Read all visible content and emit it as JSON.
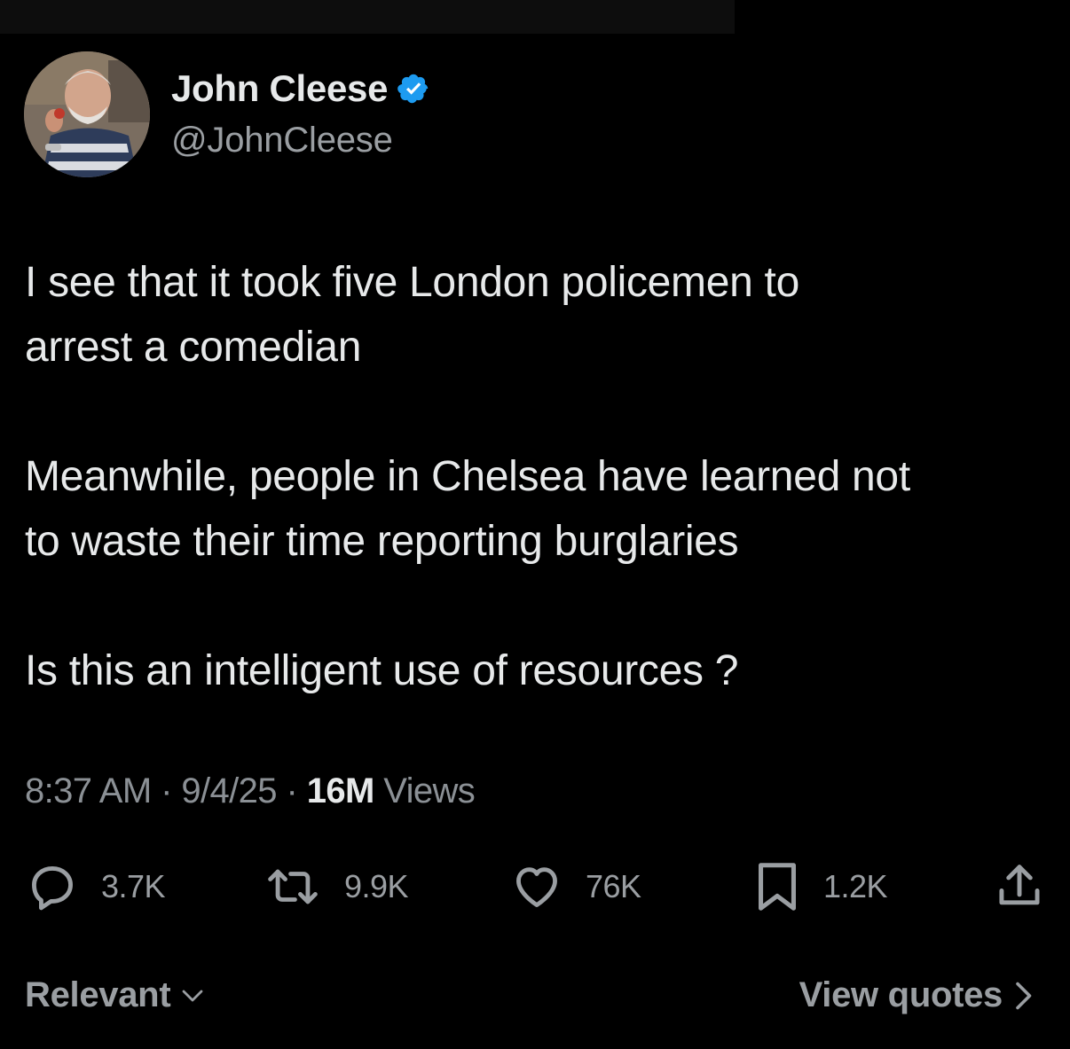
{
  "author": {
    "display_name": "John Cleese",
    "handle": "@JohnCleese",
    "verified": true,
    "verified_color": "#1d9bf0"
  },
  "tweet": {
    "paragraphs": [
      "I see that it took five London policemen to\narrest a comedian",
      "Meanwhile, people in Chelsea have learned not\nto waste their time reporting burglaries",
      "Is this an intelligent use of resources ?"
    ]
  },
  "meta": {
    "time": "8:37 AM",
    "separator": " · ",
    "date": "9/4/25",
    "views_count": "16M",
    "views_label": " Views"
  },
  "actions": {
    "replies": {
      "icon": "reply-icon",
      "count": "3.7K"
    },
    "reposts": {
      "icon": "repost-icon",
      "count": "9.9K"
    },
    "likes": {
      "icon": "heart-icon",
      "count": "76K"
    },
    "bookmarks": {
      "icon": "bookmark-icon",
      "count": "1.2K"
    },
    "share": {
      "icon": "share-icon"
    }
  },
  "footer": {
    "sort_label": "Relevant",
    "view_quotes_label": "View quotes"
  }
}
